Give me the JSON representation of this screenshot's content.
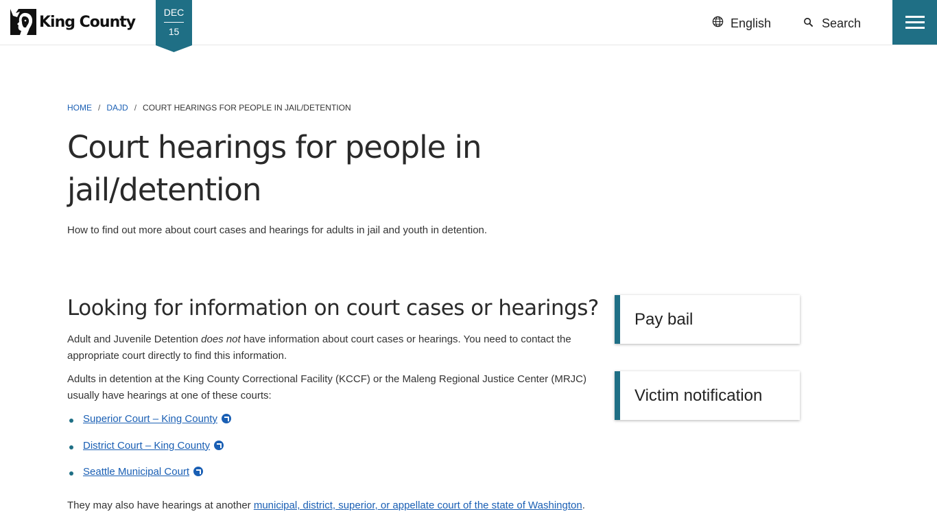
{
  "header": {
    "logo_text": "King County",
    "date": {
      "month": "DEC",
      "day": "15"
    },
    "language_label": "English",
    "search_label": "Search"
  },
  "colors": {
    "accent": "#1f6f85",
    "link": "#1a5fb4"
  },
  "breadcrumb": [
    {
      "label": "HOME"
    },
    {
      "label": "DAJD"
    },
    {
      "label": "COURT HEARINGS FOR PEOPLE IN JAIL/DETENTION"
    }
  ],
  "page": {
    "title": "Court hearings for people in jail/detention",
    "lede": "How to find out more about court cases and hearings for adults in jail and youth in detention."
  },
  "content": {
    "section_title": "Looking for information on court cases or hearings?",
    "p1_before": "Adult and Juvenile Detention ",
    "p1_emphasis": "does not",
    "p1_after": " have information about court cases or hearings. You need to contact the appropriate court directly to find this information.",
    "p2": "Adults in detention at the King County Correctional Facility (KCCF) or the Maleng Regional Justice Center (MRJC) usually have hearings at one of these courts:",
    "courts": [
      {
        "label": "Superior Court – King County"
      },
      {
        "label": "District Court – King County"
      },
      {
        "label": "Seattle Municipal Court"
      }
    ],
    "p3_before": "They may also have hearings at another ",
    "p3_link": "municipal, district, superior, or appellate court of the state of Washington",
    "p3_after": "."
  },
  "sidebar": {
    "cards": [
      {
        "label": "Pay bail"
      },
      {
        "label": "Victim notification"
      }
    ]
  }
}
